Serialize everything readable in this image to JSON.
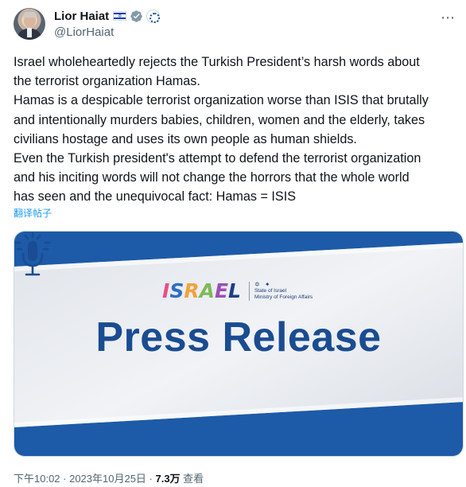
{
  "author": {
    "display_name": "Lior Haiat",
    "handle": "@LiorHaiat",
    "badges": [
      "israel-flag-icon",
      "verified-badge-icon",
      "government-emblem-icon"
    ]
  },
  "more_icon": "more-options-icon",
  "tweet": {
    "lines": [
      "Israel wholeheartedly rejects the Turkish President’s harsh words about",
      "the terrorist organization Hamas.",
      "Hamas is a despicable terrorist organization worse than ISIS that brutally",
      "and intentionally murders babies, children, women and the elderly, takes",
      "civilians hostage and uses its own people as human shields.",
      "Even the Turkish president's attempt to defend the terrorist organization",
      "and his inciting words will not change the horrors that the whole world",
      "has seen and the unequivocal fact: Hamas = ISIS"
    ],
    "translate_label": "翻译帖子"
  },
  "media": {
    "logo_letters": [
      "I",
      "S",
      "R",
      "A",
      "E",
      "L"
    ],
    "ministry_line1": "State of Israel",
    "ministry_line2": "Ministry of Foreign Affairs",
    "headline": "Press Release",
    "icon": "microphone-icon",
    "colors": {
      "headline": "#1a4c91",
      "band": "#1d5aa8",
      "background": "#e4e8ee"
    }
  },
  "meta": {
    "timestamp": "下午10:02 · 2023年10月25日 · ",
    "views_count": "7.3万",
    "views_label": " 查看"
  }
}
